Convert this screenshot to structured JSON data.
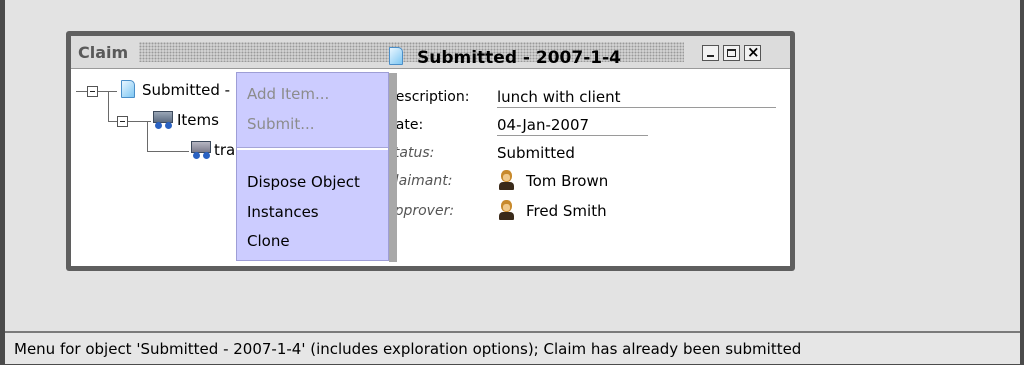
{
  "window": {
    "title": "Claim"
  },
  "tree": {
    "nodes": [
      {
        "label": "Submitted -",
        "icon": "document-icon"
      },
      {
        "label": "Items",
        "icon": "items-icon"
      },
      {
        "label": "tra",
        "icon": "item-icon"
      }
    ]
  },
  "detail": {
    "title": "Submitted - 2007-1-4",
    "fields": [
      {
        "label": "Description:",
        "value": "lunch with client"
      },
      {
        "label": "Date:",
        "value": "04-Jan-2007"
      },
      {
        "label": "Status:",
        "value": "Submitted"
      },
      {
        "label": "Claimant:",
        "value": "Tom Brown",
        "icon": "person-icon"
      },
      {
        "label": "Approver:",
        "value": "Fred Smith",
        "icon": "person-icon"
      }
    ]
  },
  "popup_menu": {
    "items": [
      {
        "label": "Add Item...",
        "enabled": false
      },
      {
        "label": "Submit...",
        "enabled": false
      },
      {
        "label": "Dispose Object",
        "enabled": true
      },
      {
        "label": "Instances",
        "enabled": true
      },
      {
        "label": "Clone",
        "enabled": true
      }
    ]
  },
  "status_bar": {
    "text": "Menu for object 'Submitted - 2007-1-4' (includes exploration options);  Claim has already been submitted"
  },
  "colors": {
    "menu_background": "#ccccff",
    "window_border": "#5f5f5f",
    "desktop_background": "#e3e3e3"
  }
}
